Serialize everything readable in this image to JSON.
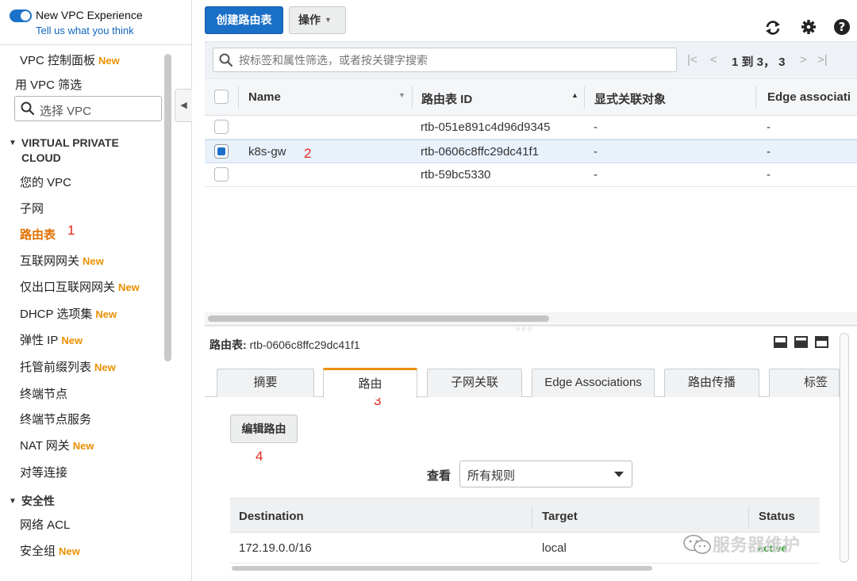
{
  "experience": {
    "title": "New VPC Experience",
    "feedback_link": "Tell us what you think",
    "enabled": true
  },
  "sidebar": {
    "dashboard": {
      "label": "VPC 控制面板",
      "badge": "New"
    },
    "filter_label": "用 VPC 筛选",
    "filter_placeholder": "选择 VPC",
    "section_vpc": "VIRTUAL PRIVATE",
    "section_vpc_2": "CLOUD",
    "items": [
      {
        "label": "您的 VPC",
        "badge": ""
      },
      {
        "label": "子网",
        "badge": ""
      },
      {
        "label": "路由表",
        "badge": "",
        "active": true
      },
      {
        "label": "互联网网关",
        "badge": "New"
      },
      {
        "label": "仅出口互联网网关",
        "badge": "New"
      },
      {
        "label": "DHCP 选项集",
        "badge": "New"
      },
      {
        "label": "弹性 IP",
        "badge": "New"
      },
      {
        "label": "托管前缀列表",
        "badge": "New"
      },
      {
        "label": "终端节点",
        "badge": ""
      },
      {
        "label": "终端节点服务",
        "badge": ""
      },
      {
        "label": "NAT 网关",
        "badge": "New"
      },
      {
        "label": "对等连接",
        "badge": ""
      }
    ],
    "section_security": "安全性",
    "security_items": [
      {
        "label": "网络 ACL",
        "badge": ""
      },
      {
        "label": "安全组",
        "badge": "New"
      }
    ]
  },
  "toolbar": {
    "create_button": "创建路由表",
    "actions_button": "操作"
  },
  "search": {
    "placeholder": "按标签和属性筛选，或者按关键字搜索"
  },
  "pagination": {
    "text": "1 到 3，  3"
  },
  "table": {
    "columns": [
      "Name",
      "路由表 ID",
      "显式关联对象",
      "Edge associati"
    ],
    "rows": [
      {
        "name": "",
        "id": "rtb-051e891c4d96d9345",
        "explicit": "-",
        "edge": "-",
        "selected": false
      },
      {
        "name": "k8s-gw",
        "id": "rtb-0606c8ffc29dc41f1",
        "explicit": "-",
        "edge": "-",
        "selected": true
      },
      {
        "name": "",
        "id": "rtb-59bc5330",
        "explicit": "-",
        "edge": "-",
        "selected": false
      }
    ]
  },
  "detail": {
    "title_label": "路由表:",
    "title_value": "rtb-0606c8ffc29dc41f1",
    "tabs": [
      "摘要",
      "路由",
      "子网关联",
      "Edge Associations",
      "路由传播",
      "标签"
    ],
    "active_tab": "路由",
    "edit_button": "编辑路由",
    "view_label": "查看",
    "view_selected": "所有规则",
    "route_columns": [
      "Destination",
      "Target",
      "Status"
    ],
    "routes": [
      {
        "destination": "172.19.0.0/16",
        "target": "local",
        "status": "active"
      }
    ]
  },
  "annotations": [
    "1",
    "2",
    "3",
    "4"
  ],
  "watermark": "服务器维护",
  "colors": {
    "primary": "#1a6fc7",
    "accent_orange": "#ec8f00",
    "annotation_red": "#e0271d",
    "status_green": "#2a9a2a"
  },
  "icons": [
    "toggle-icon",
    "search-icon",
    "refresh-icon",
    "gear-icon",
    "help-icon",
    "first-page-icon",
    "prev-page-icon",
    "next-page-icon",
    "last-page-icon",
    "collapse-icon",
    "layout-bottom-icon",
    "layout-split-icon",
    "layout-top-icon",
    "chevron-down-icon",
    "wechat-icon"
  ]
}
